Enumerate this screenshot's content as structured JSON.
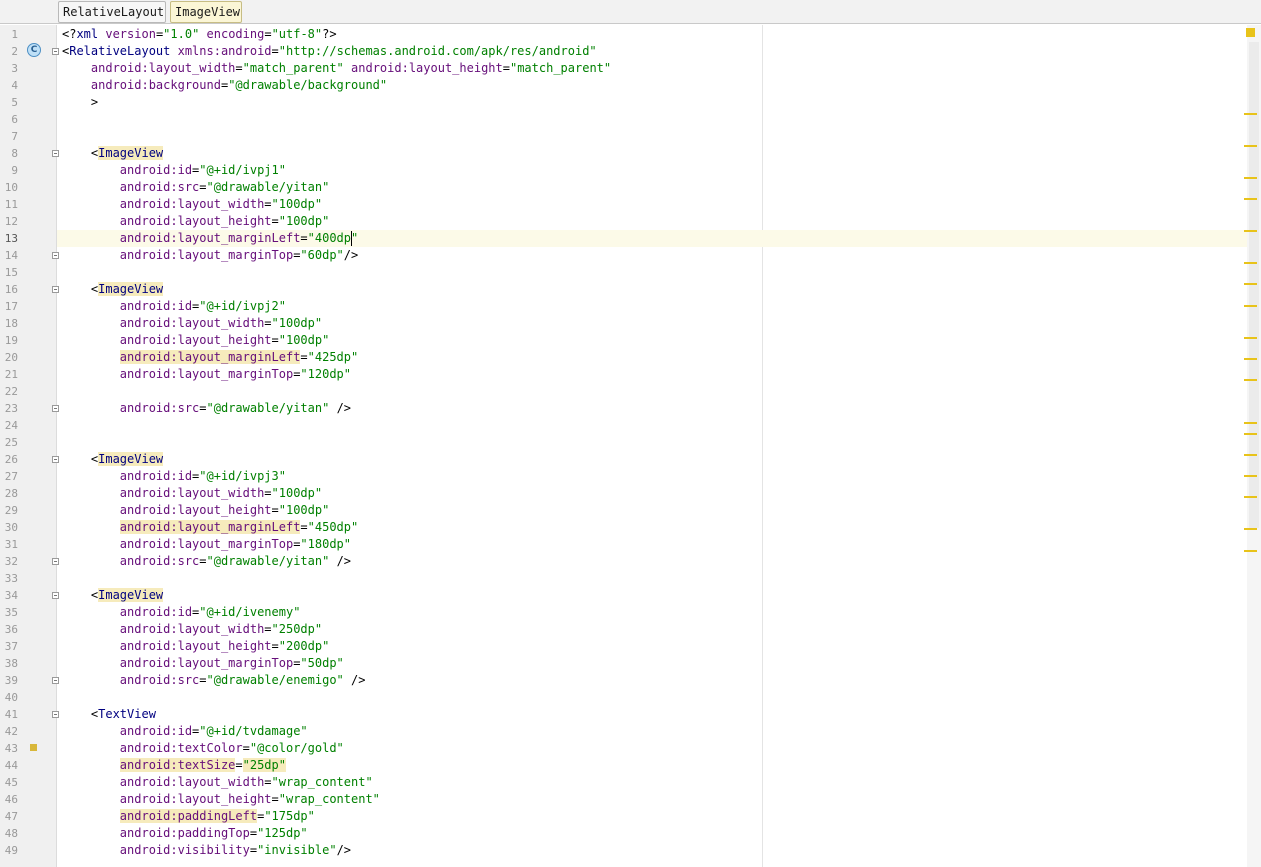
{
  "breadcrumbs": [
    {
      "label": "RelativeLayout",
      "active": false
    },
    {
      "label": "ImageView",
      "active": true
    }
  ],
  "gutter": {
    "class_marker_letter": "C",
    "class_marker_line": 2,
    "warning_marker_line": 43
  },
  "editor": {
    "current_line": 13,
    "caret_line": 13,
    "lines": [
      {
        "n": 1,
        "t": [
          [
            "punc",
            "<?"
          ],
          [
            "tag",
            "xml "
          ],
          [
            "attr",
            "version"
          ],
          [
            "punc",
            "="
          ],
          [
            "val",
            "\"1.0\""
          ],
          [
            "punc",
            " "
          ],
          [
            "attr",
            "encoding"
          ],
          [
            "punc",
            "="
          ],
          [
            "val",
            "\"utf-8\""
          ],
          [
            "punc",
            "?>"
          ]
        ]
      },
      {
        "n": 2,
        "fold": true,
        "t": [
          [
            "punc",
            "<"
          ],
          [
            "tag",
            "RelativeLayout "
          ],
          [
            "attr",
            "xmlns:android"
          ],
          [
            "punc",
            "="
          ],
          [
            "val",
            "\"http://schemas.android.com/apk/res/android\""
          ]
        ]
      },
      {
        "n": 3,
        "t": [
          [
            "punc",
            "    "
          ],
          [
            "attr",
            "android:layout_width"
          ],
          [
            "punc",
            "="
          ],
          [
            "val",
            "\"match_parent\""
          ],
          [
            "punc",
            " "
          ],
          [
            "attr",
            "android:layout_height"
          ],
          [
            "punc",
            "="
          ],
          [
            "val",
            "\"match_parent\""
          ]
        ]
      },
      {
        "n": 4,
        "t": [
          [
            "punc",
            "    "
          ],
          [
            "attr",
            "android:background"
          ],
          [
            "punc",
            "="
          ],
          [
            "val",
            "\"@drawable/background\""
          ]
        ]
      },
      {
        "n": 5,
        "t": [
          [
            "punc",
            "    >"
          ]
        ]
      },
      {
        "n": 6,
        "t": []
      },
      {
        "n": 7,
        "t": []
      },
      {
        "n": 8,
        "fold": true,
        "t": [
          [
            "punc",
            "    <"
          ],
          [
            "tag-hl",
            "ImageView"
          ]
        ]
      },
      {
        "n": 9,
        "t": [
          [
            "punc",
            "        "
          ],
          [
            "attr",
            "android:id"
          ],
          [
            "punc",
            "="
          ],
          [
            "val",
            "\"@+id/ivpj1\""
          ]
        ]
      },
      {
        "n": 10,
        "t": [
          [
            "punc",
            "        "
          ],
          [
            "attr",
            "android:src"
          ],
          [
            "punc",
            "="
          ],
          [
            "val",
            "\"@drawable/yitan\""
          ]
        ]
      },
      {
        "n": 11,
        "t": [
          [
            "punc",
            "        "
          ],
          [
            "attr",
            "android:layout_width"
          ],
          [
            "punc",
            "="
          ],
          [
            "val",
            "\"100dp\""
          ]
        ]
      },
      {
        "n": 12,
        "t": [
          [
            "punc",
            "        "
          ],
          [
            "attr",
            "android:layout_height"
          ],
          [
            "punc",
            "="
          ],
          [
            "val",
            "\"100dp\""
          ]
        ]
      },
      {
        "n": 13,
        "t": [
          [
            "punc",
            "        "
          ],
          [
            "attr",
            "android:layout_marginLeft"
          ],
          [
            "punc",
            "="
          ],
          [
            "val",
            "\"400dp\""
          ]
        ]
      },
      {
        "n": 14,
        "fold": true,
        "t": [
          [
            "punc",
            "        "
          ],
          [
            "attr",
            "android:layout_marginTop"
          ],
          [
            "punc",
            "="
          ],
          [
            "val",
            "\"60dp\""
          ],
          [
            "punc",
            "/>"
          ]
        ]
      },
      {
        "n": 15,
        "t": []
      },
      {
        "n": 16,
        "fold": true,
        "t": [
          [
            "punc",
            "    <"
          ],
          [
            "tag-hl",
            "ImageView"
          ]
        ]
      },
      {
        "n": 17,
        "t": [
          [
            "punc",
            "        "
          ],
          [
            "attr",
            "android:id"
          ],
          [
            "punc",
            "="
          ],
          [
            "val",
            "\"@+id/ivpj2\""
          ]
        ]
      },
      {
        "n": 18,
        "t": [
          [
            "punc",
            "        "
          ],
          [
            "attr",
            "android:layout_width"
          ],
          [
            "punc",
            "="
          ],
          [
            "val",
            "\"100dp\""
          ]
        ]
      },
      {
        "n": 19,
        "t": [
          [
            "punc",
            "        "
          ],
          [
            "attr",
            "android:layout_height"
          ],
          [
            "punc",
            "="
          ],
          [
            "val",
            "\"100dp\""
          ]
        ]
      },
      {
        "n": 20,
        "t": [
          [
            "punc",
            "        "
          ],
          [
            "attr-hl",
            "android:layout_marginLeft"
          ],
          [
            "punc",
            "="
          ],
          [
            "val",
            "\"425dp\""
          ]
        ]
      },
      {
        "n": 21,
        "t": [
          [
            "punc",
            "        "
          ],
          [
            "attr",
            "android:layout_marginTop"
          ],
          [
            "punc",
            "="
          ],
          [
            "val",
            "\"120dp\""
          ]
        ]
      },
      {
        "n": 22,
        "t": []
      },
      {
        "n": 23,
        "fold": true,
        "t": [
          [
            "punc",
            "        "
          ],
          [
            "attr",
            "android:src"
          ],
          [
            "punc",
            "="
          ],
          [
            "val",
            "\"@drawable/yitan\""
          ],
          [
            "punc",
            " />"
          ]
        ]
      },
      {
        "n": 24,
        "t": []
      },
      {
        "n": 25,
        "t": []
      },
      {
        "n": 26,
        "fold": true,
        "t": [
          [
            "punc",
            "    <"
          ],
          [
            "tag-hl",
            "ImageView"
          ]
        ]
      },
      {
        "n": 27,
        "t": [
          [
            "punc",
            "        "
          ],
          [
            "attr",
            "android:id"
          ],
          [
            "punc",
            "="
          ],
          [
            "val",
            "\"@+id/ivpj3\""
          ]
        ]
      },
      {
        "n": 28,
        "t": [
          [
            "punc",
            "        "
          ],
          [
            "attr",
            "android:layout_width"
          ],
          [
            "punc",
            "="
          ],
          [
            "val",
            "\"100dp\""
          ]
        ]
      },
      {
        "n": 29,
        "t": [
          [
            "punc",
            "        "
          ],
          [
            "attr",
            "android:layout_height"
          ],
          [
            "punc",
            "="
          ],
          [
            "val",
            "\"100dp\""
          ]
        ]
      },
      {
        "n": 30,
        "t": [
          [
            "punc",
            "        "
          ],
          [
            "attr-hl",
            "android:layout_marginLeft"
          ],
          [
            "punc",
            "="
          ],
          [
            "val",
            "\"450dp\""
          ]
        ]
      },
      {
        "n": 31,
        "t": [
          [
            "punc",
            "        "
          ],
          [
            "attr",
            "android:layout_marginTop"
          ],
          [
            "punc",
            "="
          ],
          [
            "val",
            "\"180dp\""
          ]
        ]
      },
      {
        "n": 32,
        "fold": true,
        "t": [
          [
            "punc",
            "        "
          ],
          [
            "attr",
            "android:src"
          ],
          [
            "punc",
            "="
          ],
          [
            "val",
            "\"@drawable/yitan\""
          ],
          [
            "punc",
            " />"
          ]
        ]
      },
      {
        "n": 33,
        "t": []
      },
      {
        "n": 34,
        "fold": true,
        "t": [
          [
            "punc",
            "    <"
          ],
          [
            "tag-hl",
            "ImageView"
          ]
        ]
      },
      {
        "n": 35,
        "t": [
          [
            "punc",
            "        "
          ],
          [
            "attr",
            "android:id"
          ],
          [
            "punc",
            "="
          ],
          [
            "val",
            "\"@+id/ivenemy\""
          ]
        ]
      },
      {
        "n": 36,
        "t": [
          [
            "punc",
            "        "
          ],
          [
            "attr",
            "android:layout_width"
          ],
          [
            "punc",
            "="
          ],
          [
            "val",
            "\"250dp\""
          ]
        ]
      },
      {
        "n": 37,
        "t": [
          [
            "punc",
            "        "
          ],
          [
            "attr",
            "android:layout_height"
          ],
          [
            "punc",
            "="
          ],
          [
            "val",
            "\"200dp\""
          ]
        ]
      },
      {
        "n": 38,
        "t": [
          [
            "punc",
            "        "
          ],
          [
            "attr",
            "android:layout_marginTop"
          ],
          [
            "punc",
            "="
          ],
          [
            "val",
            "\"50dp\""
          ]
        ]
      },
      {
        "n": 39,
        "fold": true,
        "t": [
          [
            "punc",
            "        "
          ],
          [
            "attr",
            "android:src"
          ],
          [
            "punc",
            "="
          ],
          [
            "val",
            "\"@drawable/enemigo\""
          ],
          [
            "punc",
            " />"
          ]
        ]
      },
      {
        "n": 40,
        "t": []
      },
      {
        "n": 41,
        "fold": true,
        "t": [
          [
            "punc",
            "    <"
          ],
          [
            "tag",
            "TextView"
          ]
        ]
      },
      {
        "n": 42,
        "t": [
          [
            "punc",
            "        "
          ],
          [
            "attr",
            "android:id"
          ],
          [
            "punc",
            "="
          ],
          [
            "val",
            "\"@+id/tvdamage\""
          ]
        ]
      },
      {
        "n": 43,
        "t": [
          [
            "punc",
            "        "
          ],
          [
            "attr",
            "android:textColor"
          ],
          [
            "punc",
            "="
          ],
          [
            "val",
            "\"@color/gold\""
          ]
        ]
      },
      {
        "n": 44,
        "t": [
          [
            "punc",
            "        "
          ],
          [
            "attr-hl",
            "android:textSize"
          ],
          [
            "punc",
            "="
          ],
          [
            "val-hl",
            "\"25dp\""
          ]
        ]
      },
      {
        "n": 45,
        "t": [
          [
            "punc",
            "        "
          ],
          [
            "attr",
            "android:layout_width"
          ],
          [
            "punc",
            "="
          ],
          [
            "val",
            "\"wrap_content\""
          ]
        ]
      },
      {
        "n": 46,
        "t": [
          [
            "punc",
            "        "
          ],
          [
            "attr",
            "android:layout_height"
          ],
          [
            "punc",
            "="
          ],
          [
            "val",
            "\"wrap_content\""
          ]
        ]
      },
      {
        "n": 47,
        "t": [
          [
            "punc",
            "        "
          ],
          [
            "attr-hl",
            "android:paddingLeft"
          ],
          [
            "punc",
            "="
          ],
          [
            "val",
            "\"175dp\""
          ]
        ]
      },
      {
        "n": 48,
        "t": [
          [
            "punc",
            "        "
          ],
          [
            "attr",
            "android:paddingTop"
          ],
          [
            "punc",
            "="
          ],
          [
            "val",
            "\"125dp\""
          ]
        ]
      },
      {
        "n": 49,
        "t": [
          [
            "punc",
            "        "
          ],
          [
            "attr",
            "android:visibility"
          ],
          [
            "punc",
            "="
          ],
          [
            "val",
            "\"invisible\""
          ],
          [
            "punc",
            "/>"
          ]
        ]
      }
    ]
  },
  "scroll_markers_lines": [
    5,
    8,
    11,
    13,
    16,
    19,
    21,
    23,
    26,
    28,
    30,
    34,
    35,
    37,
    39,
    41,
    44,
    46
  ],
  "colors": {
    "tag": "#000080",
    "attribute": "#660e7a",
    "value": "#008000",
    "highlight": "#f6ebbc",
    "current_line": "#fcfae8",
    "marker": "#e8c31a"
  }
}
